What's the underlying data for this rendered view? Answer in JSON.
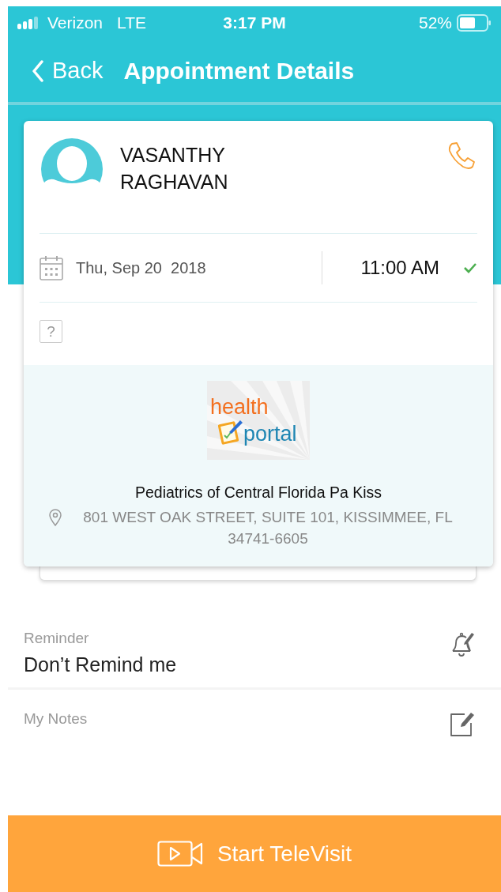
{
  "status_bar": {
    "carrier": "Verizon",
    "network": "LTE",
    "time": "3:17 PM",
    "battery_text": "52%"
  },
  "nav": {
    "back": "Back",
    "title": "Appointment Details"
  },
  "appointment": {
    "patient_name": "VASANTHY RAGHAVAN",
    "date": "Thu, Sep 20  2018",
    "time": "11:00 AM",
    "confirmed": true,
    "help": "?",
    "logo": {
      "line_1": "health",
      "line_2": "portal"
    },
    "provider": "Pediatrics of Central Florida Pa Kiss",
    "address": "801 WEST OAK STREET, SUITE 101, KISSIMMEE, FL 34741-6605"
  },
  "reminder": {
    "label": "Reminder",
    "value": "Don’t Remind me"
  },
  "notes": {
    "label": "My Notes"
  },
  "action": {
    "label": "Start TeleVisit"
  }
}
